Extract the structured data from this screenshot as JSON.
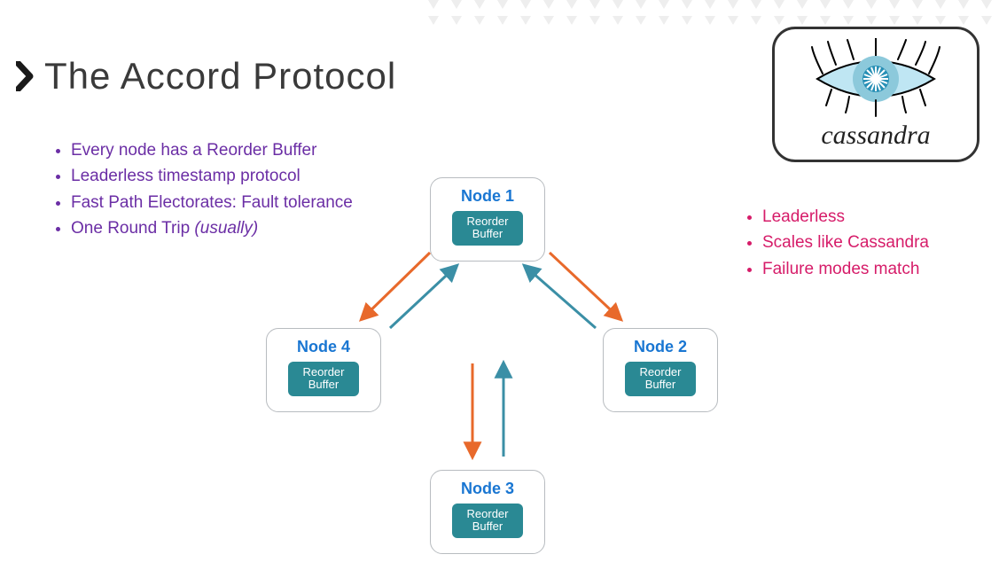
{
  "title": "The Accord Protocol",
  "left_bullets": [
    "Every node has a Reorder Buffer",
    "Leaderless timestamp protocol",
    "Fast Path Electorates: Fault tolerance",
    "One Round Trip "
  ],
  "left_bullet_last_suffix": "(usually)",
  "right_bullets": [
    "Leaderless",
    "Scales like Cassandra",
    "Failure modes match"
  ],
  "logo": {
    "label": "cassandra"
  },
  "nodes": {
    "n1": {
      "title": "Node 1",
      "buffer": "Reorder Buffer"
    },
    "n2": {
      "title": "Node 2",
      "buffer": "Reorder Buffer"
    },
    "n3": {
      "title": "Node 3",
      "buffer": "Reorder Buffer"
    },
    "n4": {
      "title": "Node 4",
      "buffer": "Reorder Buffer"
    }
  },
  "colors": {
    "purple": "#6b2ea5",
    "magenta": "#d61c69",
    "node_border": "#b8bcc0",
    "node_title": "#1976d2",
    "buffer_bg": "#2a8994",
    "arrow_orange": "#e8692b",
    "arrow_teal": "#3b8fa6"
  }
}
